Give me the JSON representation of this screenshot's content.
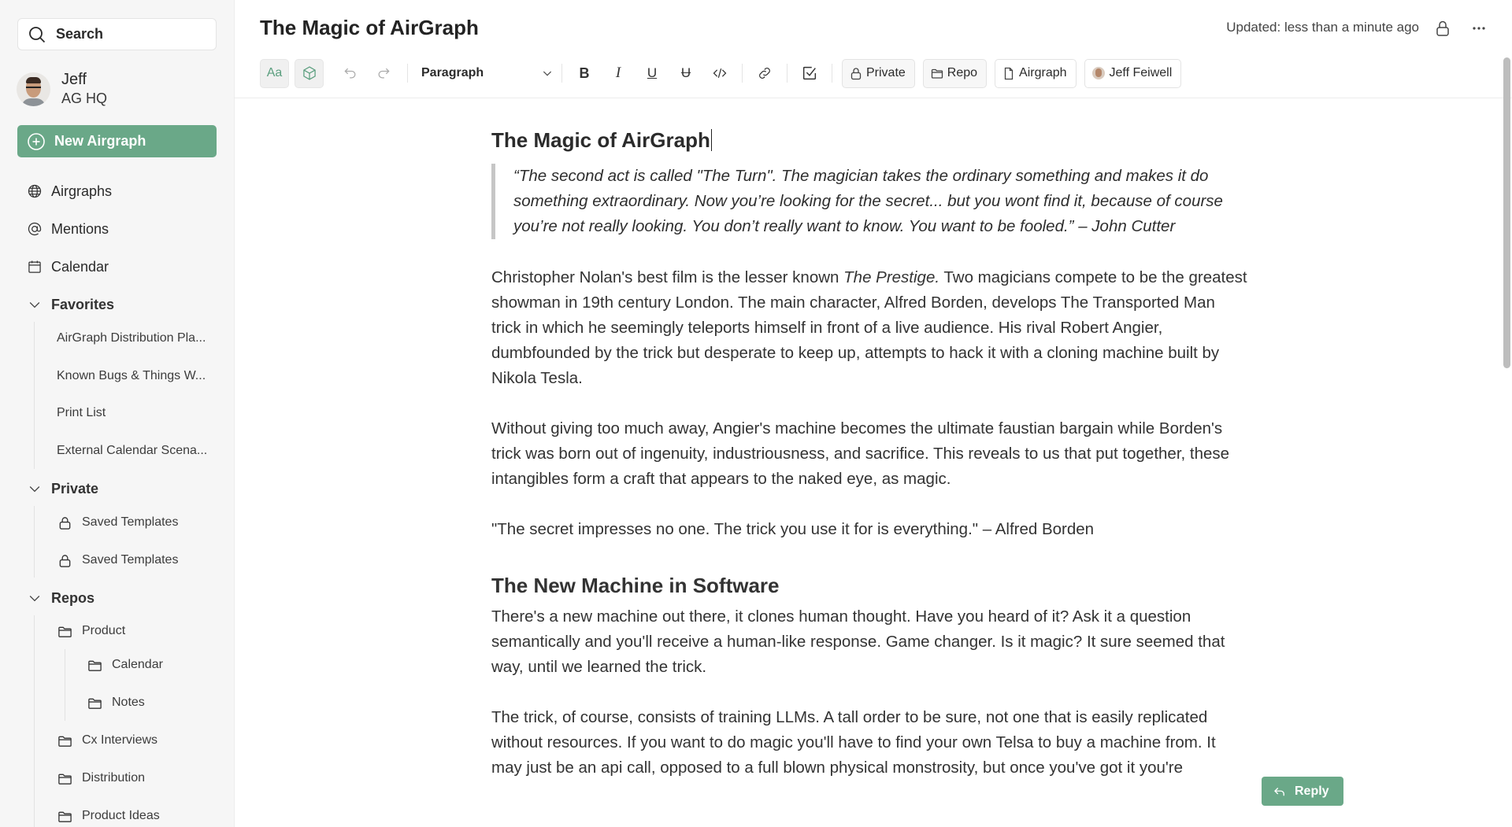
{
  "sidebar": {
    "search_label": "Search",
    "user": {
      "name": "Jeff",
      "org": "AG HQ"
    },
    "new_button": "New Airgraph",
    "nav": [
      {
        "label": "Airgraphs",
        "icon": "globe-icon"
      },
      {
        "label": "Mentions",
        "icon": "at-icon"
      },
      {
        "label": "Calendar",
        "icon": "calendar-icon"
      }
    ],
    "favorites": {
      "label": "Favorites",
      "items": [
        "AirGraph Distribution Pla...",
        "Known Bugs & Things W...",
        "Print List",
        "External Calendar Scena..."
      ]
    },
    "private": {
      "label": "Private",
      "items": [
        "Saved Templates",
        "Saved Templates"
      ]
    },
    "repos": {
      "label": "Repos",
      "items": [
        {
          "label": "Product",
          "children": [
            "Calendar",
            "Notes"
          ]
        },
        {
          "label": "Cx Interviews"
        },
        {
          "label": "Distribution"
        },
        {
          "label": "Product Ideas"
        }
      ]
    }
  },
  "header": {
    "title": "The Magic of AirGraph",
    "updated": "Updated: less than a minute ago"
  },
  "toolbar": {
    "text_style_label": "Aa",
    "block_format": "Paragraph",
    "chips": {
      "visibility": "Private",
      "repo": "Repo",
      "type": "Airgraph",
      "author": "Jeff Feiwell"
    }
  },
  "document": {
    "title": "The Magic of AirGraph",
    "quote": "“The second act is called \"The Turn\". The magician takes the ordinary something and makes it do something extraordinary. Now you’re looking for the secret... but you wont find it, because of course you’re not really looking. You don’t really want to know. You want to be fooled.” – John Cutter",
    "p1_before": "Christopher Nolan's best film is the lesser known ",
    "p1_em": "The Prestige.",
    "p1_after": " Two magicians compete to be the greatest showman in 19th century London. The main character, Alfred Borden, develops The Transported Man trick in which he seemingly teleports himself in front of a live audience. His rival Robert Angier, dumbfounded by the trick but desperate to keep up, attempts to hack it with a cloning machine built by Nikola Tesla.",
    "p2": "Without giving too much away, Angier's machine becomes the ultimate faustian bargain while Borden's trick was born out of ingenuity, industriousness, and sacrifice. This reveals to us that put together, these intangibles form a craft that appears to the naked eye, as magic.",
    "p3": "\"The secret impresses no one. The trick you use it for is everything.\" – Alfred Borden",
    "h2": "The New Machine in Software",
    "p4": "There's a new machine out there, it clones human thought. Have you heard of it? Ask it a question semantically and you'll receive a human-like response. Game changer. Is it magic? It sure seemed that way, until we learned the trick.",
    "p5": "The trick, of course, consists of training LLMs. A tall order to be sure, not one that is easily replicated without resources. If you want to do magic you'll have to find your own Telsa to buy a machine from. It may just be an api call, opposed to a full blown physical monstrosity, but once you've got it you're"
  },
  "reply_button": "Reply",
  "colors": {
    "accent": "#6aa888",
    "sidebar_bg": "#f6f6f6"
  }
}
